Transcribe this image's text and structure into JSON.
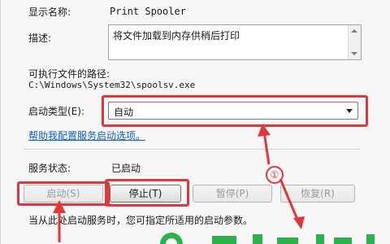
{
  "service": {
    "display_name_label": "显示名称:",
    "display_name_value": "Print Spooler",
    "description_label": "描述:",
    "description_value": "将文件加载到内存供稍后打印",
    "exe_path_label": "可执行文件的路径:",
    "exe_path_value": "C:\\Windows\\System32\\spoolsv.exe",
    "startup_type_label": "启动类型(E):",
    "startup_type_value": "自动",
    "help_link": "帮助我配置服务启动选项。",
    "status_label": "服务状态:",
    "status_value": "已启动",
    "hint_text": "当从此处启动服务时，您可指定所适用的启动参数。"
  },
  "buttons": {
    "start": "启动(S)",
    "stop": "停止(T)",
    "pause": "暂停(P)",
    "resume": "恢复(R)"
  },
  "annotation": {
    "circle_label": "①",
    "accent_color": "#e2363a"
  }
}
